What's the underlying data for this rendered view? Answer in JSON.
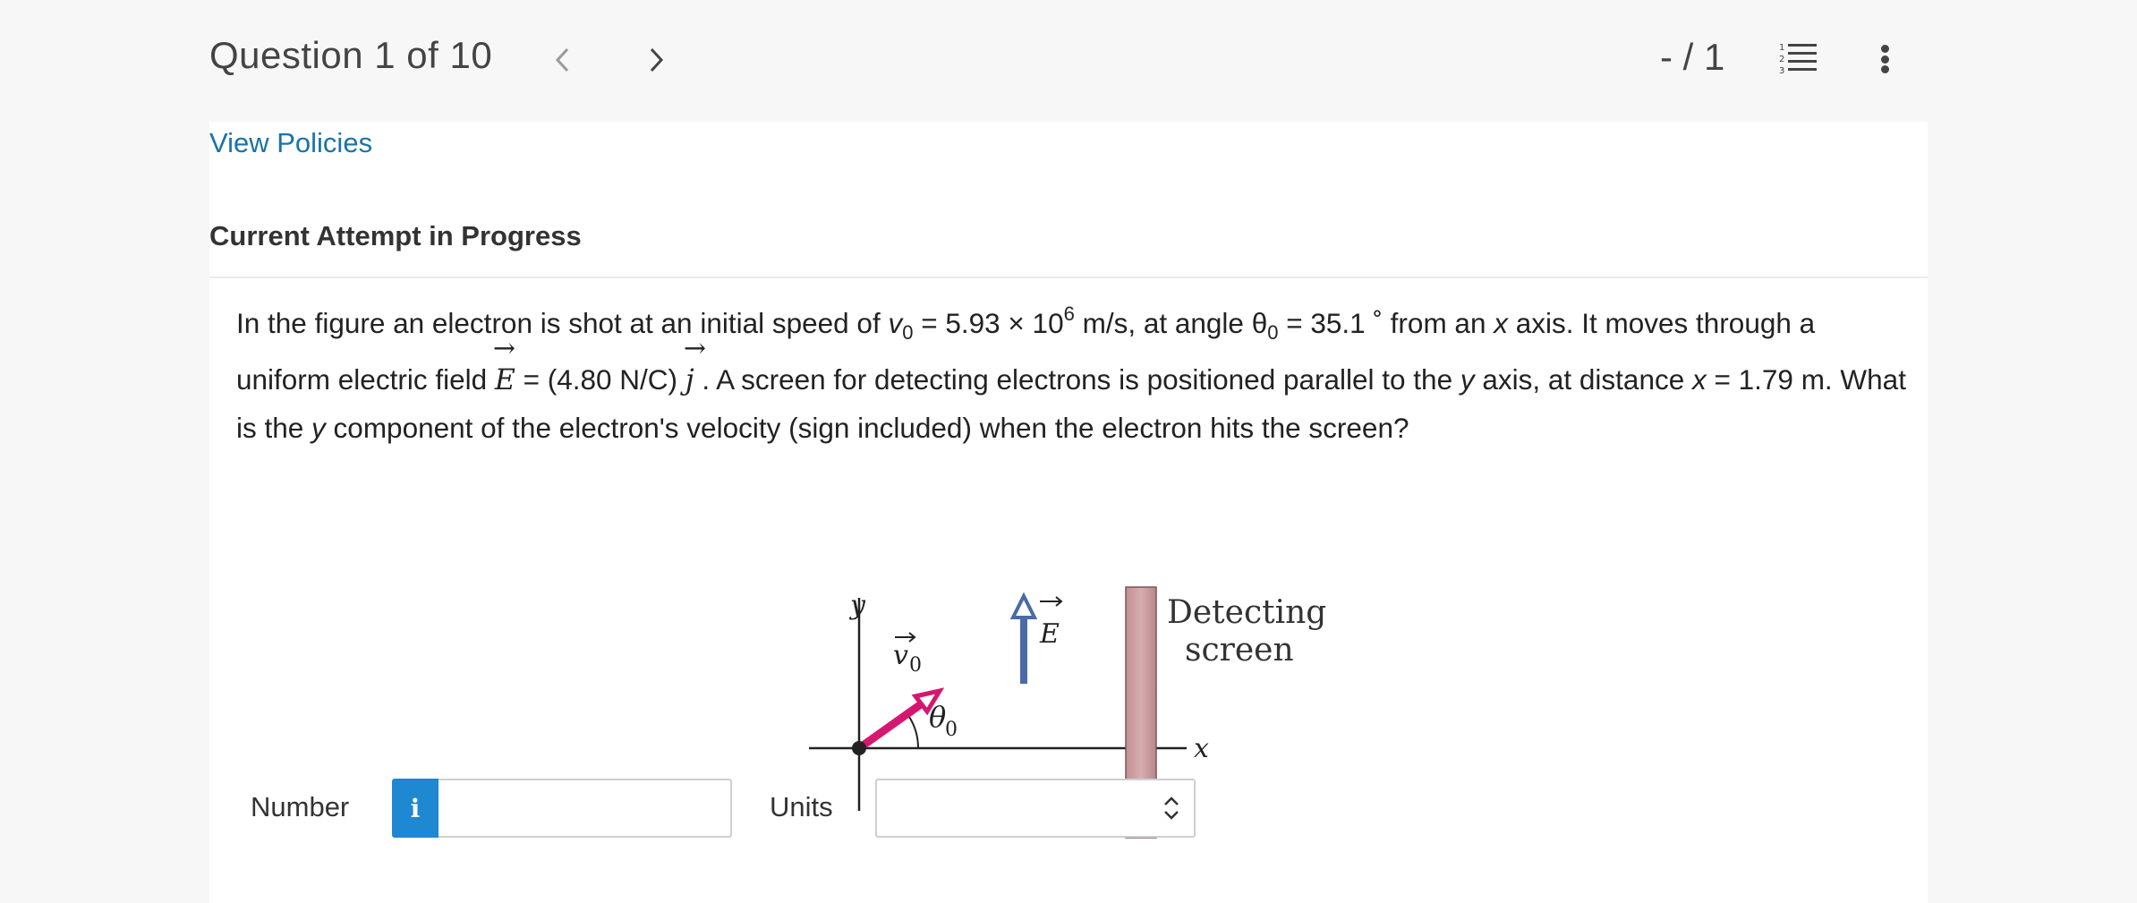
{
  "header": {
    "question_counter": "Question 1 of 10",
    "score": "- / 1",
    "prev_icon": "chevron-left-icon",
    "next_icon": "chevron-right-icon",
    "list_icon": "numbered-list-icon",
    "more_icon": "more-vertical-icon"
  },
  "links": {
    "view_policies": "View Policies"
  },
  "section": {
    "attempt_heading": "Current Attempt in Progress"
  },
  "question": {
    "t1": "In the figure an electron is shot at an initial speed of ",
    "v": "v",
    "v_sub": "0",
    "t2": " = 5.93 × 10",
    "exp": "6",
    "t3": " m/s, at angle θ",
    "theta_sub": "0",
    "t4": " = 35.1 ˚ from an ",
    "x1": "x",
    "t5": " axis. It moves through a uniform electric field ",
    "E": "E",
    "t6": " = (4.80 N/C) ",
    "j": "j",
    "t7": " . A screen for detecting electrons is positioned parallel to the ",
    "y1": "y",
    "t8": " axis, at distance ",
    "x2": "x",
    "t9": " = 1.79 m. What is the ",
    "y2": "y",
    "t10": " component of the electron's velocity (sign included) when the electron hits the screen?"
  },
  "figure": {
    "y_axis_label": "y",
    "x_axis_label": "x",
    "velocity_label": "v",
    "velocity_sub": "0",
    "angle_label": "θ",
    "angle_sub": "0",
    "field_label": "E",
    "screen_label_line1": "Detecting",
    "screen_label_line2": "screen",
    "colors": {
      "velocity_arrow": "#d6176f",
      "field_arrow": "#4a6aa8",
      "screen": "#cfa3a6"
    }
  },
  "answer": {
    "number_label": "Number",
    "number_value": "",
    "info_icon": "info-icon",
    "units_label": "Units",
    "units_selected": ""
  }
}
